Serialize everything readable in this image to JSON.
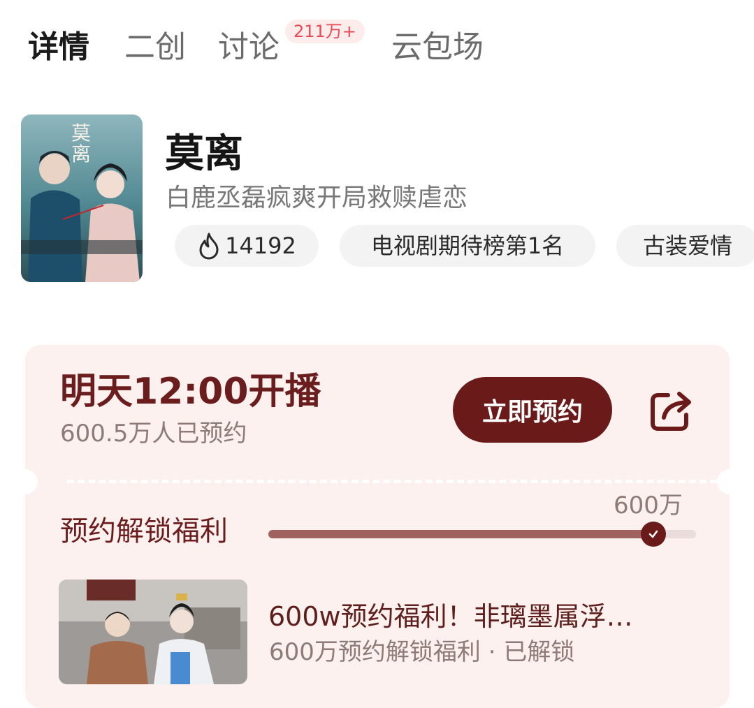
{
  "tabs": [
    {
      "label": "详情"
    },
    {
      "label": "二创"
    },
    {
      "label": "讨论",
      "badge": "211万+"
    },
    {
      "label": "云包场"
    }
  ],
  "show": {
    "title": "莫离",
    "subtitle": "白鹿丞磊疯爽开局救赎虐恋",
    "poster_text": "莫离",
    "tags": [
      {
        "label": "14192",
        "icon": "flame-icon"
      },
      {
        "label": "电视剧期待榜第1名"
      },
      {
        "label": "古装爱情"
      }
    ]
  },
  "reservation": {
    "airtime": "明天12:00开播",
    "reserved_count": "600.5万人已预约",
    "button_label": "立即预约",
    "share_icon": "share-icon",
    "unlock_label": "预约解锁福利",
    "milestone_label": "600万",
    "progress_fraction": 0.9
  },
  "benefit": {
    "title": "600w预约福利！非璃墨属浮…",
    "subtitle": "600万预约解锁福利 · 已解锁"
  },
  "colors": {
    "accent": "#6a1a19",
    "card_bg": "#fcf1ef",
    "badge_text": "#e64a55"
  }
}
